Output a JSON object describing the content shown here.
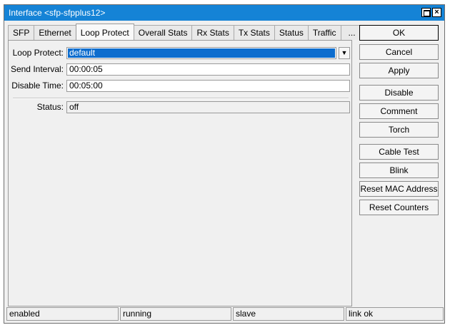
{
  "window": {
    "title": "Interface <sfp-sfpplus12>"
  },
  "tabs": [
    {
      "label": "SFP"
    },
    {
      "label": "Ethernet"
    },
    {
      "label": "Loop Protect"
    },
    {
      "label": "Overall Stats"
    },
    {
      "label": "Rx Stats"
    },
    {
      "label": "Tx Stats"
    },
    {
      "label": "Status"
    },
    {
      "label": "Traffic"
    },
    {
      "label": "..."
    }
  ],
  "active_tab": "Loop Protect",
  "form": {
    "loop_protect": {
      "label": "Loop Protect:",
      "value": "default"
    },
    "send_interval": {
      "label": "Send Interval:",
      "value": "00:00:05"
    },
    "disable_time": {
      "label": "Disable Time:",
      "value": "00:05:00"
    },
    "status": {
      "label": "Status:",
      "value": "off"
    }
  },
  "buttons": {
    "ok": "OK",
    "cancel": "Cancel",
    "apply": "Apply",
    "disable": "Disable",
    "comment": "Comment",
    "torch": "Torch",
    "cable_test": "Cable Test",
    "blink": "Blink",
    "reset_mac": "Reset MAC Address",
    "reset_counters": "Reset Counters"
  },
  "statusbar": [
    "enabled",
    "running",
    "slave",
    "link ok"
  ],
  "colors": {
    "titlebar": "#1583d6",
    "selection": "#0d6dce",
    "window_bg": "#f0f0f0"
  }
}
